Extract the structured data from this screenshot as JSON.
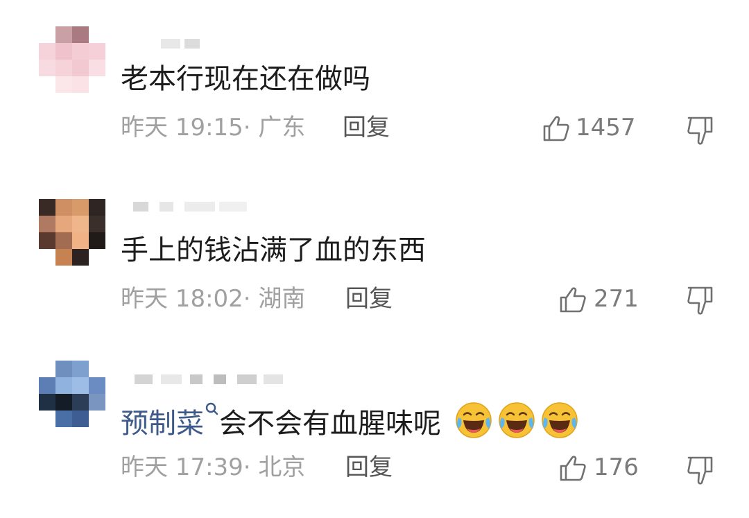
{
  "comments": [
    {
      "text": "老本行现在还在做吗",
      "time": "昨天 19:15",
      "location": "广东",
      "reply_label": "回复",
      "likes": "1457"
    },
    {
      "text": "手上的钱沾满了血的东西",
      "time": "昨天 18:02",
      "location": "湖南",
      "reply_label": "回复",
      "likes": "271"
    },
    {
      "topic": "预制菜",
      "text": "会不会有血腥味呢",
      "time": "昨天 17:39",
      "location": "北京",
      "reply_label": "回复",
      "likes": "176",
      "emojis": [
        "laugh-cry-emoji",
        "laugh-cry-emoji",
        "laugh-cry-emoji"
      ]
    }
  ],
  "icons": {
    "like": "thumbs-up-icon",
    "dislike": "thumbs-down-icon",
    "topic": "search-icon"
  },
  "colors": {
    "topic_link": "#3d5a8a",
    "meta_text": "#a0a0a0",
    "reply_text": "#555555",
    "emoji_yellow": "#f7c236"
  }
}
